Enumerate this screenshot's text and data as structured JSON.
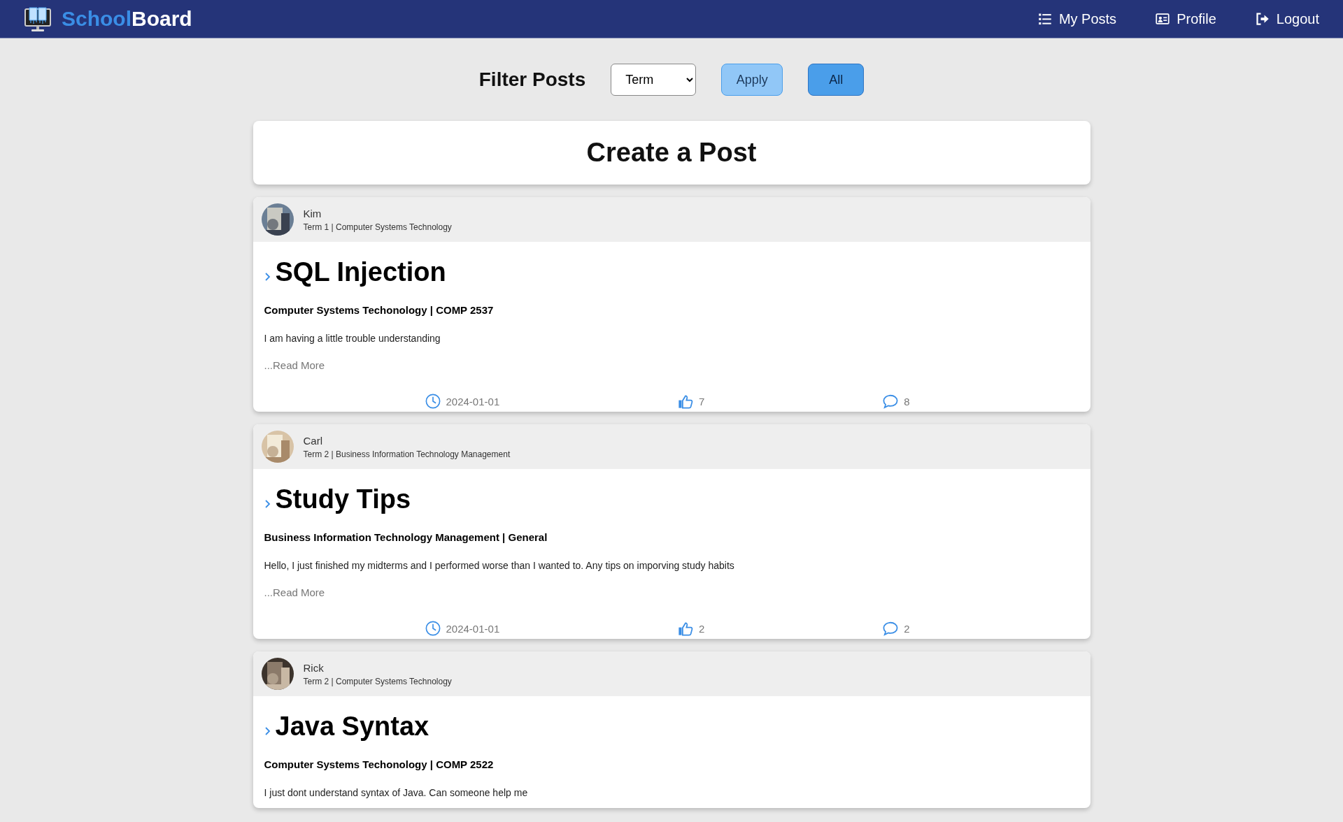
{
  "nav": {
    "brand": {
      "first": "School",
      "second": "Board"
    },
    "links": [
      {
        "kind": "list",
        "label": "My Posts"
      },
      {
        "kind": "card",
        "label": "Profile"
      },
      {
        "kind": "logout",
        "label": "Logout"
      }
    ]
  },
  "filter": {
    "title": "Filter Posts",
    "select": "Term",
    "buttons": [
      {
        "label": "Apply",
        "selected": false
      },
      {
        "label": "All",
        "selected": true
      }
    ]
  },
  "create": {
    "label": "Create a Post"
  },
  "posts": [
    {
      "author": "Kim",
      "meta": "Term 1 | Computer Systems Technology",
      "title": "SQL Injection",
      "subtitle": "Computer Systems Techonology | COMP 2537",
      "body": "I am having a little trouble understanding",
      "read_more": "...Read More",
      "date": "2024-01-01",
      "likes": "7",
      "comments": "8"
    },
    {
      "author": "Carl",
      "meta": "Term 2 | Business Information Technology Management",
      "title": "Study Tips",
      "subtitle": "Business Information Technology Management | General",
      "body": "Hello, I just finished my midterms and I performed worse than I wanted to. Any tips on imporving study habits",
      "read_more": "...Read More",
      "date": "2024-01-01",
      "likes": "2",
      "comments": "2"
    },
    {
      "author": "Rick",
      "meta": "Term 2 | Computer Systems Technology",
      "title": "Java Syntax",
      "subtitle": "Computer Systems Techonology | COMP 2522",
      "body": "I just dont understand syntax of Java. Can someone help me"
    }
  ]
}
